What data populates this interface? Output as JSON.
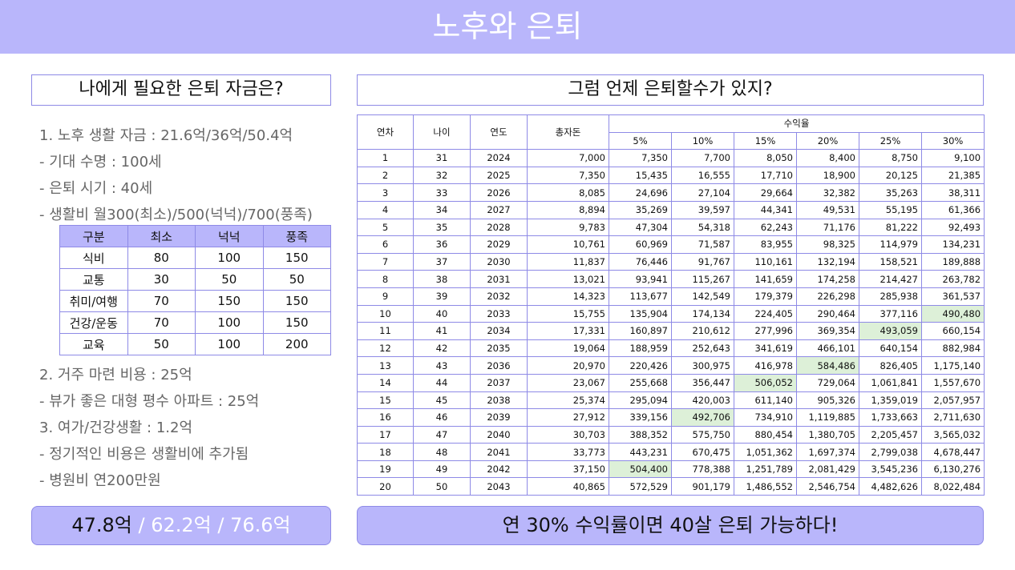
{
  "header": {
    "title": "노후와 은퇴"
  },
  "left": {
    "title": "나에게 필요한 은퇴 자금은?",
    "lines": [
      "1. 노후 생활 자금 : 21.6억/36억/50.4억",
      " - 기대 수명 : 100세",
      " - 은퇴 시기 : 40세",
      " - 생활비 월300(최소)/500(넉넉)/700(풍족)",
      "2. 거주 마련 비용 : 25억",
      " - 뷰가 좋은 대형 평수 아파트 : 25억",
      "3. 여가/건강생활 : 1.2억",
      " - 정기적인 비용은 생활비에 추가됨",
      " - 병원비 연200만원"
    ],
    "expense_table": {
      "headers": [
        "구분",
        "최소",
        "넉넉",
        "풍족"
      ],
      "rows": [
        [
          "식비",
          "80",
          "100",
          "150"
        ],
        [
          "교통",
          "30",
          "50",
          "50"
        ],
        [
          "취미/여행",
          "70",
          "150",
          "150"
        ],
        [
          "건강/운동",
          "70",
          "100",
          "150"
        ],
        [
          "교육",
          "50",
          "100",
          "200"
        ]
      ]
    },
    "summary": {
      "part1": "47.8억",
      "part2": " / 62.2억 / 76.6억"
    }
  },
  "right": {
    "title": "그럼 언제 은퇴할수가 있지?",
    "table": {
      "col_headers": [
        "연차",
        "나이",
        "연도",
        "총자돈"
      ],
      "group_header": "수익율",
      "rates": [
        "5%",
        "10%",
        "15%",
        "20%",
        "25%",
        "30%"
      ],
      "rows": [
        [
          "1",
          "31",
          "2024",
          "7,000",
          "7,350",
          "7,700",
          "8,050",
          "8,400",
          "8,750",
          "9,100"
        ],
        [
          "2",
          "32",
          "2025",
          "7,350",
          "15,435",
          "16,555",
          "17,710",
          "18,900",
          "20,125",
          "21,385"
        ],
        [
          "3",
          "33",
          "2026",
          "8,085",
          "24,696",
          "27,104",
          "29,664",
          "32,382",
          "35,263",
          "38,311"
        ],
        [
          "4",
          "34",
          "2027",
          "8,894",
          "35,269",
          "39,597",
          "44,341",
          "49,531",
          "55,195",
          "61,366"
        ],
        [
          "5",
          "35",
          "2028",
          "9,783",
          "47,304",
          "54,318",
          "62,243",
          "71,176",
          "81,222",
          "92,493"
        ],
        [
          "6",
          "36",
          "2029",
          "10,761",
          "60,969",
          "71,587",
          "83,955",
          "98,325",
          "114,979",
          "134,231"
        ],
        [
          "7",
          "37",
          "2030",
          "11,837",
          "76,446",
          "91,767",
          "110,161",
          "132,194",
          "158,521",
          "189,888"
        ],
        [
          "8",
          "38",
          "2031",
          "13,021",
          "93,941",
          "115,267",
          "141,659",
          "174,258",
          "214,427",
          "263,782"
        ],
        [
          "9",
          "39",
          "2032",
          "14,323",
          "113,677",
          "142,549",
          "179,379",
          "226,298",
          "285,938",
          "361,537"
        ],
        [
          "10",
          "40",
          "2033",
          "15,755",
          "135,904",
          "174,134",
          "224,405",
          "290,464",
          "377,116",
          "490,480"
        ],
        [
          "11",
          "41",
          "2034",
          "17,331",
          "160,897",
          "210,612",
          "277,996",
          "369,354",
          "493,059",
          "660,154"
        ],
        [
          "12",
          "42",
          "2035",
          "19,064",
          "188,959",
          "252,643",
          "341,619",
          "466,101",
          "640,154",
          "882,984"
        ],
        [
          "13",
          "43",
          "2036",
          "20,970",
          "220,426",
          "300,975",
          "416,978",
          "584,486",
          "826,405",
          "1,175,140"
        ],
        [
          "14",
          "44",
          "2037",
          "23,067",
          "255,668",
          "356,447",
          "506,052",
          "729,064",
          "1,061,841",
          "1,557,670"
        ],
        [
          "15",
          "45",
          "2038",
          "25,374",
          "295,094",
          "420,003",
          "611,140",
          "905,326",
          "1,359,019",
          "2,057,957"
        ],
        [
          "16",
          "46",
          "2039",
          "27,912",
          "339,156",
          "492,706",
          "734,910",
          "1,119,885",
          "1,733,663",
          "2,711,630"
        ],
        [
          "17",
          "47",
          "2040",
          "30,703",
          "388,352",
          "575,750",
          "880,454",
          "1,380,705",
          "2,205,457",
          "3,565,032"
        ],
        [
          "18",
          "48",
          "2041",
          "33,773",
          "443,231",
          "670,475",
          "1,051,362",
          "1,697,374",
          "2,799,038",
          "4,678,447"
        ],
        [
          "19",
          "49",
          "2042",
          "37,150",
          "504,400",
          "778,388",
          "1,251,789",
          "2,081,429",
          "3,545,236",
          "6,130,276"
        ],
        [
          "20",
          "50",
          "2043",
          "40,865",
          "572,529",
          "901,179",
          "1,486,552",
          "2,546,754",
          "4,482,626",
          "8,022,484"
        ]
      ],
      "highlight_color": "#ddf0d8",
      "highlights": [
        [
          9,
          9
        ],
        [
          10,
          8
        ],
        [
          12,
          7
        ],
        [
          13,
          6
        ],
        [
          15,
          5
        ],
        [
          18,
          4
        ]
      ]
    },
    "conclusion": "연 30% 수익률이면 40살 은퇴 가능하다!"
  },
  "colors": {
    "accent": "#b9b6fb",
    "border": "#8e8ae6",
    "highlight": "#ddf0d8"
  }
}
